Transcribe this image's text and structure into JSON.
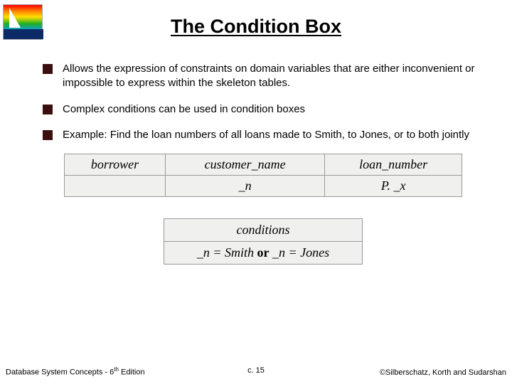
{
  "title": "The Condition Box",
  "bullets": [
    "Allows the expression of constraints on domain variables that are either inconvenient or impossible to express within the skeleton tables.",
    "Complex conditions can be used in condition boxes",
    "Example: Find the loan numbers of all loans made to Smith, to Jones, or to both jointly"
  ],
  "table1": {
    "headers": [
      "borrower",
      "customer_name",
      "loan_number"
    ],
    "row": [
      "",
      "_n",
      "P. _x"
    ]
  },
  "table2": {
    "header": "conditions",
    "row_parts": {
      "a": "_n = Smith ",
      "op": "or",
      "b": " _n = Jones"
    }
  },
  "footer": {
    "left_prefix": "Database System Concepts - 6",
    "left_sup": "th",
    "left_suffix": " Edition",
    "center": "c. 15",
    "right": "©Silberschatz, Korth and Sudarshan"
  }
}
